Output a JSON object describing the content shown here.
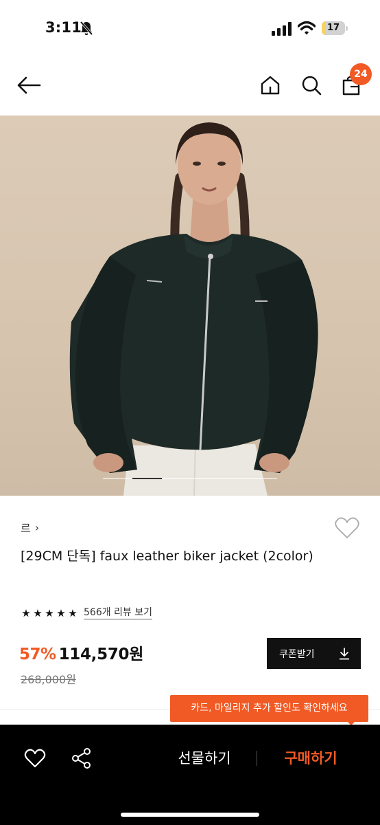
{
  "status_bar": {
    "time": "3:11",
    "battery_level": "17",
    "battery_fraction": 0.17,
    "icons": [
      "bell-slash-icon",
      "signal-icon",
      "wifi-icon",
      "battery-icon"
    ]
  },
  "nav": {
    "icons": [
      "back-arrow-icon",
      "home-icon",
      "search-icon",
      "cart-icon"
    ],
    "cart_count": "24",
    "accent": "#f15a24"
  },
  "gallery": {
    "current_fraction": 0.17
  },
  "product": {
    "brand": "르",
    "brand_chevron": "›",
    "title": "[29CM 단독] faux leather biker jacket (2color)",
    "rating_stars": 5,
    "review_text": "566개 리뷰 보기",
    "discount": "57%",
    "sale_price": "114,570원",
    "original_price": "268,000원"
  },
  "coupon": {
    "label": "쿠폰받기"
  },
  "tooltip": {
    "text": "카드, 마일리지 추가 할인도 확인하세요"
  },
  "bottom_bar": {
    "gift_label": "선물하기",
    "buy_label": "구매하기",
    "icons": [
      "heart-icon",
      "share-icon"
    ]
  },
  "colors": {
    "accent": "#f15a24",
    "dark": "#111111",
    "bottom_bar_bg": "#000000",
    "hero_bg": "#d8c6b0"
  }
}
